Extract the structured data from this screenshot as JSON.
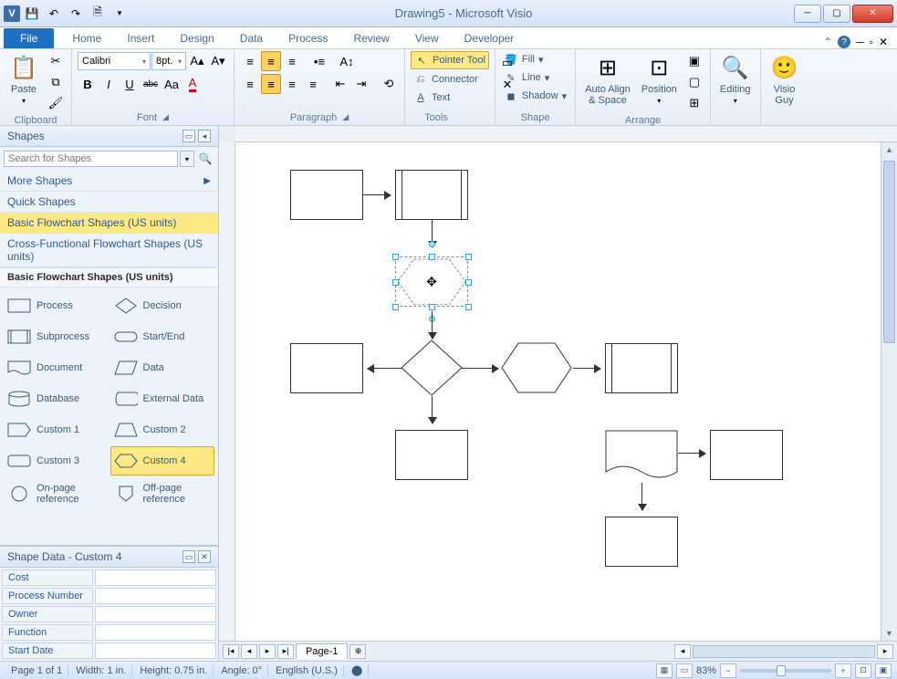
{
  "window": {
    "title": "Drawing5 - Microsoft Visio",
    "app_letter": "V"
  },
  "tabs": {
    "file": "File",
    "items": [
      "Home",
      "Insert",
      "Design",
      "Data",
      "Process",
      "Review",
      "View",
      "Developer"
    ]
  },
  "ribbon": {
    "clipboard": {
      "paste": "Paste",
      "label": "Clipboard"
    },
    "font": {
      "name": "Calibri",
      "size": "8pt.",
      "label": "Font",
      "bold": "B",
      "italic": "I",
      "underline": "U",
      "strike": "abc",
      "case": "Aa"
    },
    "paragraph": {
      "label": "Paragraph"
    },
    "tools": {
      "pointer": "Pointer Tool",
      "connector": "Connector",
      "text": "Text",
      "label": "Tools"
    },
    "shape": {
      "fill": "Fill",
      "line": "Line",
      "shadow": "Shadow",
      "label": "Shape"
    },
    "arrange": {
      "autoalign": "Auto Align\n& Space",
      "position": "Position",
      "label": "Arrange"
    },
    "editing": {
      "label": "Editing"
    },
    "visioguy": {
      "label": "Visio\nGuy"
    }
  },
  "shapes_panel": {
    "title": "Shapes",
    "search_placeholder": "Search for Shapes",
    "more": "More Shapes",
    "quick": "Quick Shapes",
    "stencils": [
      "Basic Flowchart Shapes (US units)",
      "Cross-Functional Flowchart Shapes (US units)"
    ],
    "active_stencil": "Basic Flowchart Shapes (US units)",
    "shapes": [
      {
        "name": "Process"
      },
      {
        "name": "Decision"
      },
      {
        "name": "Subprocess"
      },
      {
        "name": "Start/End"
      },
      {
        "name": "Document"
      },
      {
        "name": "Data"
      },
      {
        "name": "Database"
      },
      {
        "name": "External Data"
      },
      {
        "name": "Custom 1"
      },
      {
        "name": "Custom 2"
      },
      {
        "name": "Custom 3"
      },
      {
        "name": "Custom 4"
      },
      {
        "name": "On-page reference"
      },
      {
        "name": "Off-page reference"
      }
    ]
  },
  "shape_data": {
    "title": "Shape Data - Custom 4",
    "rows": [
      "Cost",
      "Process Number",
      "Owner",
      "Function",
      "Start Date"
    ]
  },
  "page_tabs": {
    "page1": "Page-1"
  },
  "status": {
    "page": "Page 1 of 1",
    "width": "Width: 1 in.",
    "height": "Height: 0.75 in.",
    "angle": "Angle: 0°",
    "lang": "English (U.S.)",
    "zoom": "83%"
  }
}
